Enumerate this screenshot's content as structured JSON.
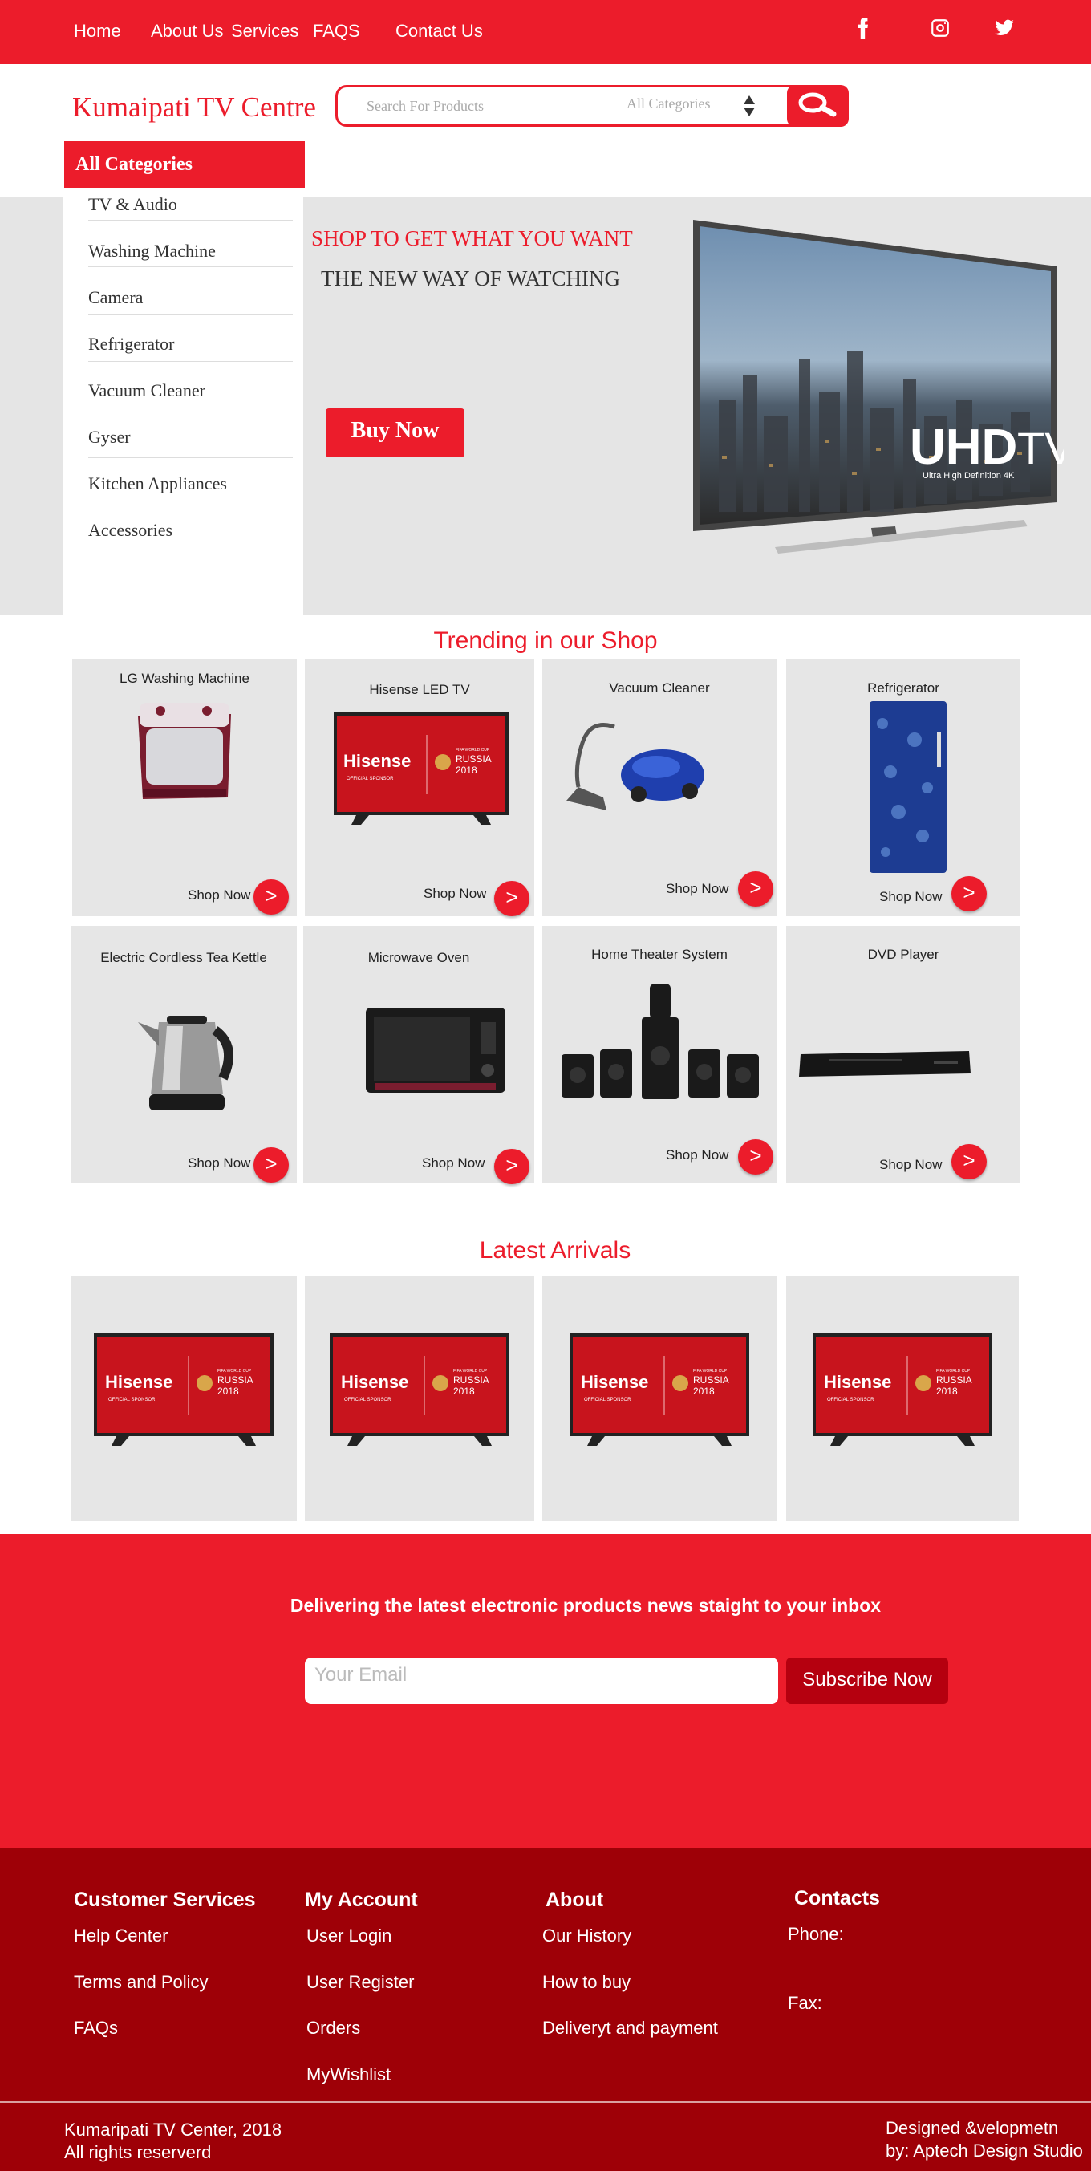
{
  "nav": {
    "links": [
      "Home",
      "About Us",
      "Services",
      "FAQS",
      "Contact Us"
    ],
    "social": [
      "facebook-icon",
      "instagram-icon",
      "twitter-icon"
    ]
  },
  "header": {
    "brand": "Kumaipati TV Centre",
    "search_placeholder": "Search For Products",
    "category_select": "All Categories"
  },
  "categories": {
    "heading": "All Categories",
    "items": [
      "TV & Audio",
      "Washing Machine",
      "Camera",
      "Refrigerator",
      "Vacuum Cleaner",
      "Gyser",
      "Kitchen Appliances",
      "Accessories"
    ]
  },
  "hero": {
    "title1": "SHOP TO GET WHAT YOU WANT",
    "title2": "THE NEW WAY OF WATCHING",
    "button": "Buy Now",
    "tv_brand": "UHD",
    "tv_brand_suffix": "TV",
    "tv_sub": "Ultra High Definition 4K"
  },
  "trending": {
    "title": "Trending in our Shop",
    "shop_now": "Shop Now",
    "arrow": ">",
    "items": [
      "LG Washing Machine",
      "Hisense LED TV",
      "Vacuum Cleaner",
      "Refrigerator",
      "Electric Cordless Tea Kettle",
      "Microwave Oven",
      "Home Theater System",
      "DVD Player"
    ]
  },
  "hisense": {
    "logo": "Hisense",
    "sponsor": "OFFICIAL SPONSOR",
    "event": "FIFA WORLD CUP",
    "country": "RUSSIA",
    "year": "2018"
  },
  "latest": {
    "title": "Latest Arrivals"
  },
  "newsletter": {
    "text": "Delivering the latest electronic products news staight to your inbox",
    "email_placeholder": "Your Email",
    "button": "Subscribe Now"
  },
  "footer": {
    "columns": [
      {
        "heading": "Customer Services",
        "links": [
          "Help Center",
          "Terms and Policy",
          "FAQs"
        ]
      },
      {
        "heading": "My Account",
        "links": [
          "User Login",
          "User Register",
          "Orders",
          "MyWishlist"
        ]
      },
      {
        "heading": "About",
        "links": [
          "Our History",
          "How to buy",
          "Deliveryt and payment"
        ]
      },
      {
        "heading": "Contacts",
        "links": [
          "Phone:",
          "Fax:"
        ]
      }
    ],
    "copyright_line1": "Kumaripati TV Center, 2018",
    "copyright_line2": "All rights reserverd",
    "credit_line1": "Designed &velopmetn",
    "credit_line2": "by: Aptech Design Studio"
  },
  "colors": {
    "primary": "#ec1c2b",
    "dark": "#9e0007",
    "panel": "#e6e6e6"
  }
}
